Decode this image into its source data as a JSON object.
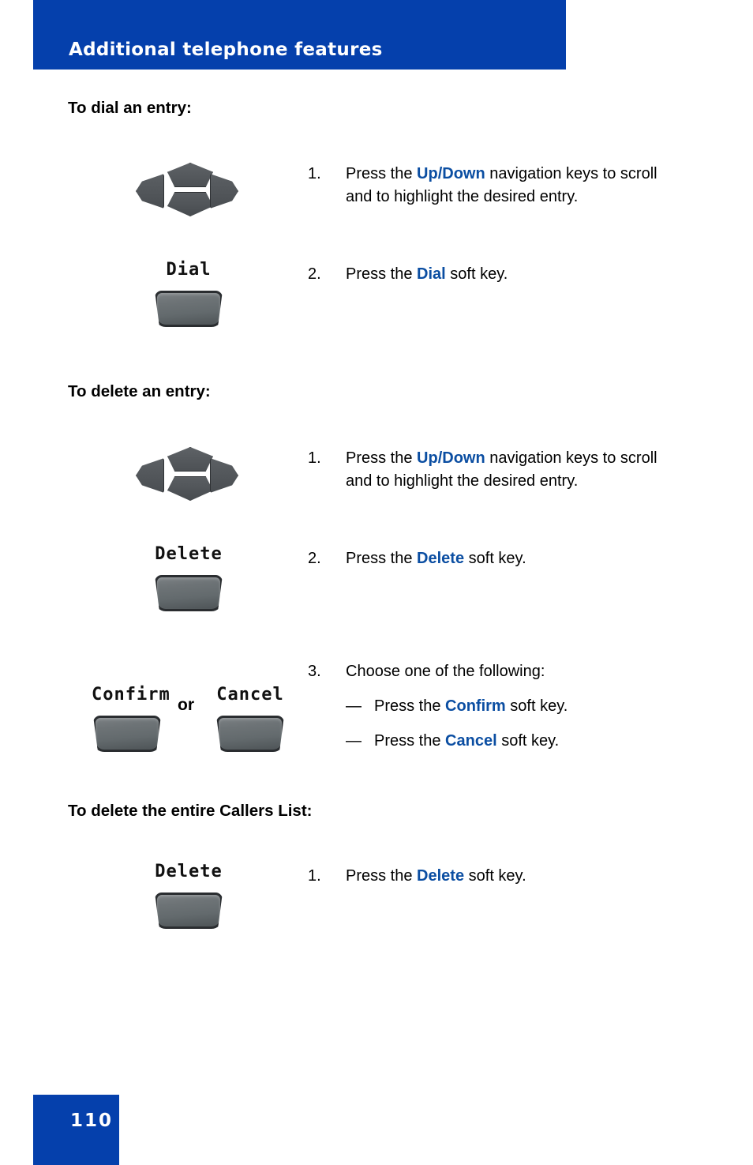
{
  "header": {
    "title": "Additional telephone features",
    "bg_color": "#0540ac"
  },
  "sections": [
    {
      "heading": "To dial an entry:",
      "steps": [
        {
          "number": "1.",
          "graphic": "navigation-keys",
          "text_before": "Press the ",
          "keyword": "Up/Down",
          "text_after": " navigation keys to scroll and to highlight the desired entry."
        },
        {
          "number": "2.",
          "graphic": "soft-key",
          "softkey_label": "Dial",
          "text_before": "Press the ",
          "keyword": "Dial",
          "text_after": " soft key."
        }
      ]
    },
    {
      "heading": "To delete an entry:",
      "steps": [
        {
          "number": "1.",
          "graphic": "navigation-keys",
          "text_before": "Press the ",
          "keyword": "Up/Down",
          "text_after": " navigation keys to scroll and to highlight the desired entry."
        },
        {
          "number": "2.",
          "graphic": "soft-key",
          "softkey_label": "Delete",
          "text_before": "Press the ",
          "keyword": "Delete",
          "text_after": " soft key."
        },
        {
          "number": "3.",
          "graphic": "soft-key-pair",
          "softkey_label_left": "Confirm",
          "softkey_label_right": "Cancel",
          "or_label": "or",
          "text": "Choose one of the following:",
          "sub_items": [
            {
              "dash": "—",
              "text_before": "Press the ",
              "keyword": "Confirm",
              "text_after": " soft key."
            },
            {
              "dash": "—",
              "text_before": "Press the ",
              "keyword": "Cancel",
              "text_after": " soft key."
            }
          ]
        }
      ]
    },
    {
      "heading": "To delete the entire Callers List:",
      "steps": [
        {
          "number": "1.",
          "graphic": "soft-key",
          "softkey_label": "Delete",
          "text_before": "Press the ",
          "keyword": "Delete",
          "text_after": " soft key."
        }
      ]
    }
  ],
  "footer": {
    "page_number": "110",
    "bg_color": "#0540ac"
  },
  "colors": {
    "brand_blue": "#0540ac",
    "keyword_blue": "#0b4ea2",
    "key_gray": "#5b5f63",
    "key_border": "#2a2d30"
  }
}
